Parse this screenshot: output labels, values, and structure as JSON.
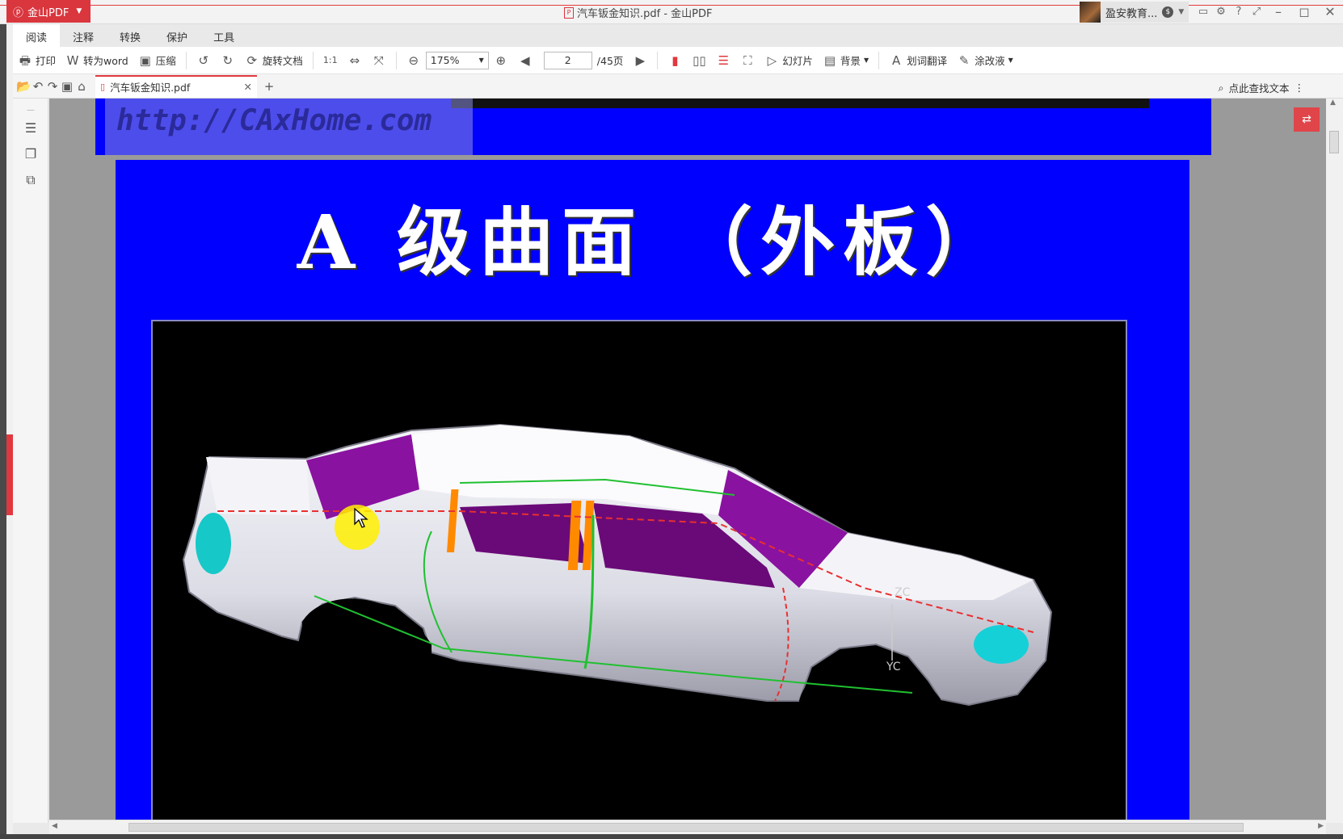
{
  "app": {
    "name": "金山PDF",
    "title": "汽车钣金知识.pdf - 金山PDF"
  },
  "user": {
    "name": "盈安教育..."
  },
  "ribbon_tabs": [
    "阅读",
    "注释",
    "转换",
    "保护",
    "工具"
  ],
  "toolbar": {
    "print": "打印",
    "to_word": "转为word",
    "compress": "压缩",
    "rotate_doc": "旋转文档",
    "zoom": "175%",
    "page_current": "2",
    "page_total": "/45页",
    "slideshow": "幻灯片",
    "background": "背景",
    "translate": "划词翻译",
    "correction": "涂改液"
  },
  "doc_tab": {
    "name": "汽车钣金知识.pdf"
  },
  "find": {
    "placeholder": "点此查找文本"
  },
  "pages": {
    "watermark": "http://CAxHome.com",
    "slide_title": "A 级曲面 （外板）",
    "axis_z": "ZC",
    "axis_y": "YC"
  },
  "colors": {
    "accent": "#e0383e",
    "page_bg": "#0000ff",
    "body_white": "#f2f2f6",
    "glass": "#7a0a8a",
    "pillar": "#ff8a00"
  }
}
